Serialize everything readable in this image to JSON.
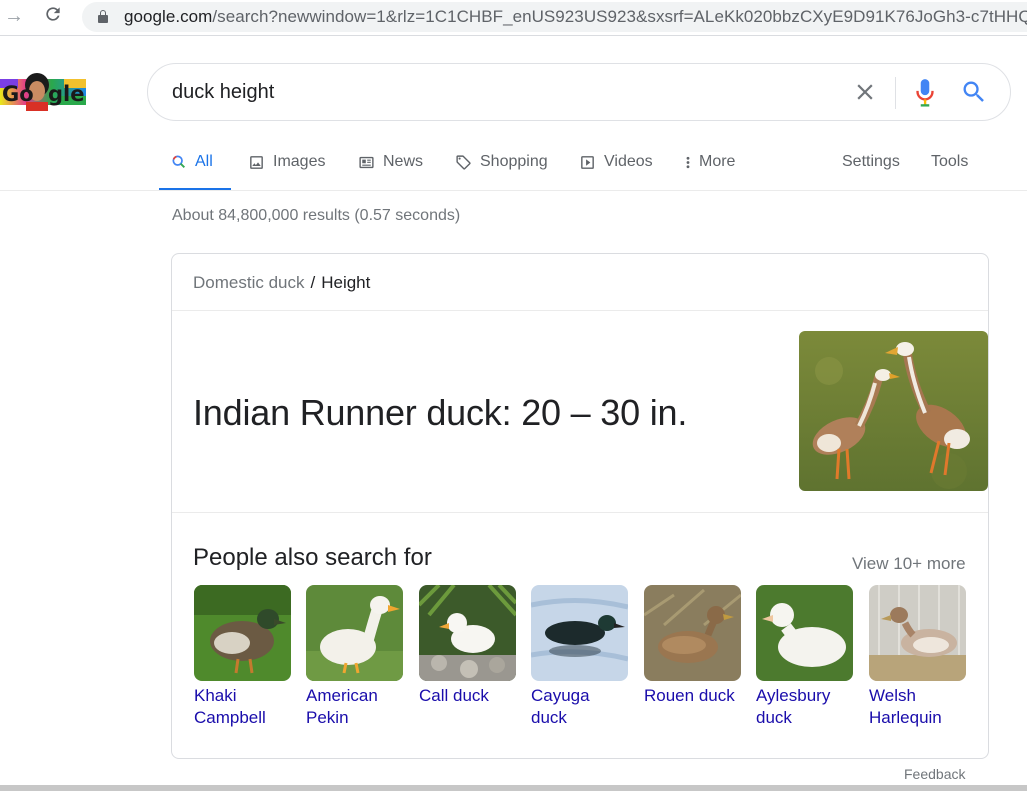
{
  "browser": {
    "url_host": "google.com",
    "url_path": "/search?newwindow=1&rlz=1C1CHBF_enUS923US923&sxsrf=ALeKk020bbzCXyE9D91K76JoGh3-c7tHHQ"
  },
  "search": {
    "query": "duck height"
  },
  "tabs": [
    {
      "label": "All"
    },
    {
      "label": "Images"
    },
    {
      "label": "News"
    },
    {
      "label": "Shopping"
    },
    {
      "label": "Videos"
    },
    {
      "label": "More"
    },
    {
      "label": "Settings"
    },
    {
      "label": "Tools"
    }
  ],
  "result_stats": "About 84,800,000 results (0.57 seconds)",
  "knowledge_panel": {
    "breadcrumb_parent": "Domestic duck",
    "breadcrumb_separator": "/",
    "breadcrumb_current": "Height",
    "answer": "Indian Runner duck: 20 – 30 in.",
    "people_also_search_title": "People also search for",
    "view_more": "View 10+ more",
    "items": [
      {
        "label_line1": "Khaki",
        "label_line2": "Campbell"
      },
      {
        "label_line1": "American",
        "label_line2": "Pekin"
      },
      {
        "label_line1": "Call duck",
        "label_line2": ""
      },
      {
        "label_line1": "Cayuga",
        "label_line2": "duck"
      },
      {
        "label_line1": "Rouen duck",
        "label_line2": ""
      },
      {
        "label_line1": "Aylesbury",
        "label_line2": "duck"
      },
      {
        "label_line1": "Welsh",
        "label_line2": "Harlequin"
      }
    ]
  },
  "feedback": "Feedback",
  "colors": {
    "accent": "#1a73e8",
    "link": "#1a0dab",
    "muted": "#70757a"
  }
}
